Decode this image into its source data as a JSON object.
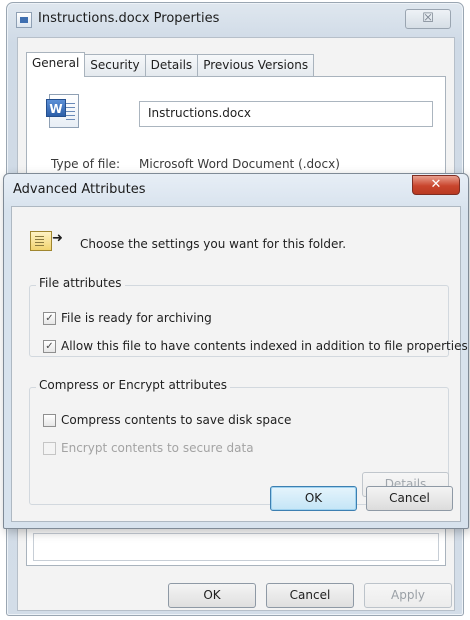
{
  "properties_window": {
    "title": "Instructions.docx Properties",
    "close_glyph": "☒",
    "tabs": [
      {
        "label": "General",
        "active": true
      },
      {
        "label": "Security",
        "active": false
      },
      {
        "label": "Details",
        "active": false
      },
      {
        "label": "Previous Versions",
        "active": false
      }
    ],
    "file_name": "Instructions.docx",
    "file_icon_letter": "W",
    "type_label": "Type of file:",
    "type_value": "Microsoft Word Document (.docx)",
    "buttons": {
      "ok": "OK",
      "cancel": "Cancel",
      "apply": "Apply"
    }
  },
  "advanced_dialog": {
    "title": "Advanced Attributes",
    "close_glyph": "✕",
    "instruction": "Choose the settings you want for this folder.",
    "file_attributes": {
      "title": "File attributes",
      "options": [
        {
          "label": "File is ready for archiving",
          "checked": true,
          "enabled": true
        },
        {
          "label": "Allow this file to have contents indexed in addition to file properties",
          "checked": true,
          "enabled": true
        }
      ]
    },
    "compress_encrypt": {
      "title": "Compress or Encrypt attributes",
      "options": [
        {
          "label": "Compress contents to save disk space",
          "checked": false,
          "enabled": true
        },
        {
          "label": "Encrypt contents to secure data",
          "checked": false,
          "enabled": false
        }
      ],
      "details_button": "Details"
    },
    "buttons": {
      "ok": "OK",
      "cancel": "Cancel"
    }
  },
  "icons": {
    "file_icon": "word-document-icon",
    "folder_icon": "folder-attributes-icon",
    "check_glyph": "✓"
  },
  "colors": {
    "dialog_close": "#c9452d",
    "default_button_border": "#3c7fb1",
    "window_frame": "#d3dde8"
  }
}
